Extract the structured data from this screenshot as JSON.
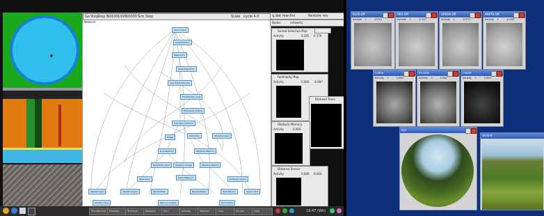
{
  "left_screen": {
    "toolbar_items": [
      "Go",
      "Stop",
      "Step 5",
      "10",
      "100",
      "1000",
      "10000",
      "Sim Step",
      "Scale",
      "cycle 4.0",
      "q.dat rew-Xnl",
      "Restore rev"
    ],
    "network_label": "Network",
    "nodes_label": "Nodes",
    "nodes_value": "networks",
    "panels": [
      {
        "title": "Sorted Selection Map",
        "activity": "Activity",
        "value": "0.205",
        "value2": "0.176"
      },
      {
        "title": "Familiarity Map",
        "activity": "Activity",
        "value": "0.000",
        "value2": "-0.087"
      },
      {
        "title": "Obstacle Memory",
        "activity": "Activity",
        "value": "0.000",
        "value2": ""
      },
      {
        "title": "Distance Sensor",
        "activity": "Activity",
        "value": "0.000",
        "value2": "0.000"
      }
    ],
    "overlap_panel_title": "Demand Trace",
    "graph_nodes": [
      "Goal output",
      "GoalSelection",
      "Reward for",
      "State Trajectory",
      "Goal ExpectationAc",
      "FP Attention Goal",
      "Familiarity Output",
      "Goal Recollections",
      "Obstacle Input",
      "Odometry",
      "Target",
      "Goal Memory",
      "Obstacle Memory",
      "Familiarity Input",
      "Obstacle Shape",
      "Obstacle Detect",
      "Goal Input",
      "Odom2Memory",
      "Distance Sensor",
      "Spatial Input",
      "Spatial Output",
      "ParticleFilter",
      "DistanceFilter",
      "Goal Neuron",
      "Sensor SCA",
      "Activity Trace",
      "Memory Output",
      "Dist Output"
    ],
    "taskbar_items": [
      "Thunderbird",
      "Desktop",
      "Terminal",
      "Network",
      "Sim",
      "Activity",
      "Monitor",
      "Cam",
      "Sensor",
      "Goal"
    ],
    "clock": "19:47 (Wh)"
  },
  "right_screen": {
    "windows": [
      {
        "title": "BLUE-Off",
        "activity": "Activity",
        "plus": "+",
        "minus": "-",
        "value": "-0.915"
      },
      {
        "title": "RED-Off",
        "activity": "Activity",
        "plus": "+",
        "minus": "-",
        "value": "-1.107"
      },
      {
        "title": "GREEN-Off",
        "activity": "Activity",
        "plus": "+",
        "minus": "-",
        "value": "-0.271"
      },
      {
        "title": "WHITE-Off",
        "activity": "Activity",
        "plus": "+",
        "minus": "-",
        "value": "-0.190"
      },
      {
        "title": "I-cone",
        "activity": "Activity",
        "plus": "+",
        "minus": "-",
        "value": "0.000"
      },
      {
        "title": "m-cone",
        "activity": "Activity",
        "plus": "+",
        "minus": "-",
        "value": "0.000"
      },
      {
        "title": "r-cone",
        "activity": "Activity",
        "plus": "+",
        "minus": "-",
        "value": "0.000"
      }
    ],
    "image_windows": [
      {
        "title": "eye"
      },
      {
        "title": "second"
      }
    ]
  },
  "colors": {
    "right_bg": "#0d2f7a",
    "node_fill": "#bfe0f5",
    "title_blue": "#2d5ab8",
    "close_red": "#d23a2e"
  }
}
